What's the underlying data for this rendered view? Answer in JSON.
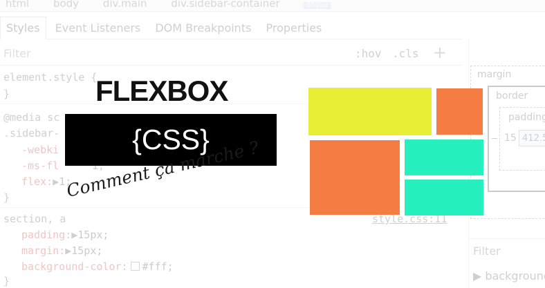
{
  "devtools": {
    "breadcrumb": [
      "html",
      "body",
      "div.main",
      "div.sidebar-container",
      "650px"
    ],
    "tabs": [
      "Styles",
      "Event Listeners",
      "DOM Breakpoints",
      "Properties"
    ],
    "filter_placeholder": "Filter",
    "hov": ":hov",
    "cls": ".cls",
    "add": "+",
    "rules": {
      "element_style_open": "element.style {",
      "element_style_close": "}",
      "media_query": "@media sc",
      "sidebar_selector": ".sidebar-",
      "webkit_prop": "-webki",
      "ms_prop": "-ms-fl",
      "ms_suffix": "1;",
      "flex_prop": "flex:",
      "flex_val": "1;",
      "sidebar_close": "}",
      "section_selector": "section, a",
      "source_link": "style.css:11",
      "padding_prop": "padding:",
      "padding_val": "15px;",
      "margin_prop": "margin:",
      "margin_val": "15px;",
      "bg_prop": "background-color:",
      "bg_val": "#fff;",
      "section_close": "}"
    },
    "box_model": {
      "margin_label": "margin",
      "border_label": "border",
      "padding_label": "padding",
      "dash": "–",
      "left_value": "15",
      "content_value": "412.5"
    },
    "right_filter": "Filter",
    "right_background": "background"
  },
  "hero": {
    "title": "FLEXBOX",
    "css_label": "{CSS}",
    "tagline": "Comment ça marche ?"
  },
  "blocks": {
    "yellow": "#e8ee35",
    "orange": "#f57d43",
    "teal": "#26f0bd"
  }
}
